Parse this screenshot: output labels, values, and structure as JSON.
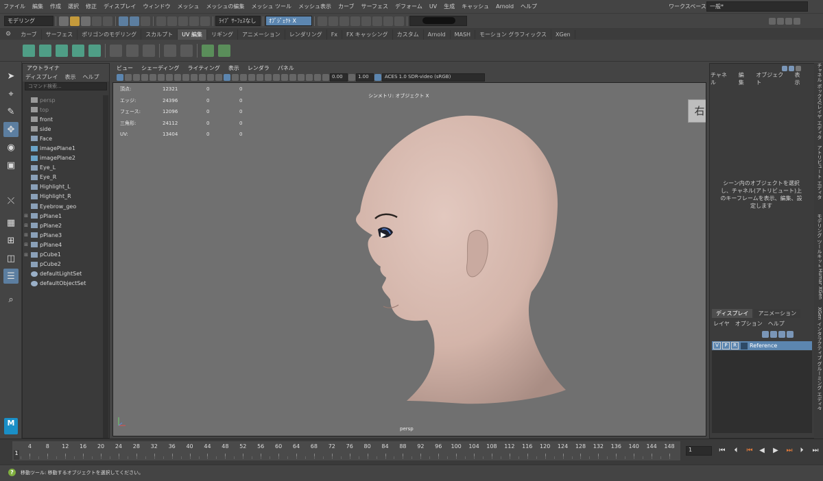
{
  "menubar": {
    "items": [
      "ファイル",
      "編集",
      "作成",
      "選択",
      "修正",
      "ディスプレイ",
      "ウィンドウ",
      "メッシュ",
      "メッシュの編集",
      "メッシュ ツール",
      "メッシュ表示",
      "カーブ",
      "サーフェス",
      "デフォーム",
      "UV",
      "生成",
      "キャッシュ",
      "Arnold",
      "ヘルプ"
    ],
    "workspace_label": "ワークスペース:",
    "workspace_value": "一般*"
  },
  "statusline": {
    "mode": "モデリング",
    "live_surface": "ﾗｲﾌﾞ ｻｰﾌｪｽなし",
    "symmetry": "ｵﾌﾞｼﾞｪｸﾄ X"
  },
  "shelf": {
    "tabs": [
      "カーブ",
      "サーフェス",
      "ポリゴンのモデリング",
      "スカルプト",
      "UV 編集",
      "リギング",
      "アニメーション",
      "レンダリング",
      "Fx",
      "FX キャッシング",
      "カスタム",
      "Arnold",
      "MASH",
      "モーション グラフィックス",
      "XGen"
    ],
    "active_tab": "UV 編集"
  },
  "outliner": {
    "title": "アウトライナ",
    "menu": [
      "ディスプレイ",
      "表示",
      "ヘルプ"
    ],
    "search_placeholder": "コマンド検索...",
    "items": [
      {
        "label": "persp",
        "icon": "camera-icon",
        "expand": "",
        "dim": true
      },
      {
        "label": "top",
        "icon": "camera-icon",
        "expand": "",
        "dim": true
      },
      {
        "label": "front",
        "icon": "camera-icon",
        "expand": "",
        "dim": false
      },
      {
        "label": "side",
        "icon": "camera-icon",
        "expand": "",
        "dim": false
      },
      {
        "label": "Face",
        "icon": "transform-icon",
        "expand": "",
        "dim": false
      },
      {
        "label": "imagePlane1",
        "icon": "image-plane-icon",
        "expand": "",
        "dim": false
      },
      {
        "label": "imagePlane2",
        "icon": "image-plane-icon",
        "expand": "",
        "dim": false
      },
      {
        "label": "Eye_L",
        "icon": "transform-icon",
        "expand": "",
        "dim": false
      },
      {
        "label": "Eye_R",
        "icon": "transform-icon",
        "expand": "",
        "dim": false
      },
      {
        "label": "Highlight_L",
        "icon": "transform-icon",
        "expand": "",
        "dim": false
      },
      {
        "label": "Highlight_R",
        "icon": "transform-icon",
        "expand": "",
        "dim": false
      },
      {
        "label": "Eyebrow_geo",
        "icon": "transform-icon",
        "expand": "",
        "dim": false
      },
      {
        "label": "pPlane1",
        "icon": "transform-icon",
        "expand": "⊞",
        "dim": false
      },
      {
        "label": "pPlane2",
        "icon": "transform-icon",
        "expand": "⊞",
        "dim": false
      },
      {
        "label": "pPlane3",
        "icon": "transform-icon",
        "expand": "⊞",
        "dim": false
      },
      {
        "label": "pPlane4",
        "icon": "transform-icon",
        "expand": "⊞",
        "dim": false
      },
      {
        "label": "pCube1",
        "icon": "transform-icon",
        "expand": "⊞",
        "dim": false
      },
      {
        "label": "pCube2",
        "icon": "transform-icon",
        "expand": "",
        "dim": false
      },
      {
        "label": "defaultLightSet",
        "icon": "set-icon",
        "expand": "",
        "dim": false
      },
      {
        "label": "defaultObjectSet",
        "icon": "set-icon",
        "expand": "",
        "dim": false
      }
    ]
  },
  "viewport": {
    "menu": [
      "ビュー",
      "シェーディング",
      "ライティング",
      "表示",
      "レンダラ",
      "パネル"
    ],
    "field_a": "0.00",
    "field_b": "1.00",
    "color_space": "ACES 1.0 SDR-video (sRGB)",
    "hud": [
      {
        "label": "頂点:",
        "v": "12321",
        "a": "0",
        "b": "0"
      },
      {
        "label": "エッジ:",
        "v": "24396",
        "a": "0",
        "b": "0"
      },
      {
        "label": "フェース:",
        "v": "12096",
        "a": "0",
        "b": "0"
      },
      {
        "label": "三角形:",
        "v": "24112",
        "a": "0",
        "b": "0"
      },
      {
        "label": "UV:",
        "v": "13404",
        "a": "0",
        "b": "0"
      }
    ],
    "symmetry_label": "シンメトリ: オブジェクト X",
    "view_cube": "右",
    "camera": "persp"
  },
  "channel_box": {
    "menu": [
      "チャネル",
      "編集",
      "オブジェクト",
      "表示"
    ],
    "message": "シーン内のオブジェクトを選択し、チャネル(アトリビュート)上のキーフレームを表示、編集、設定します",
    "side_tabs": [
      "チャネル ボックス/レイヤ エディタ",
      "アトリビュート エディタ",
      "モデリング ツールキット",
      "Human IK",
      "XGen",
      "XGen インタラクティブ グルーミング エディタ"
    ]
  },
  "layer_editor": {
    "tabs": [
      "ディスプレイ",
      "アニメーション"
    ],
    "menu": [
      "レイヤ",
      "オプション",
      "ヘルプ"
    ],
    "layer": {
      "v": "V",
      "p": "P",
      "r": "R",
      "name": "Reference"
    }
  },
  "timeline": {
    "ticks": [
      "1",
      "4",
      "8",
      "12",
      "16",
      "20",
      "24",
      "28",
      "32",
      "36",
      "40",
      "44",
      "48",
      "52",
      "56",
      "60",
      "64",
      "68",
      "72",
      "76",
      "80",
      "84",
      "88",
      "92",
      "96",
      "100",
      "104",
      "108",
      "112",
      "116",
      "120",
      "124",
      "128",
      "132",
      "136",
      "140",
      "144",
      "148"
    ],
    "current_frame": "1",
    "current_label": "1"
  },
  "helpline": {
    "text": "移動ツール: 移動するオブジェクトを選択してください。"
  },
  "colors": {
    "accent": "#5c86b0",
    "viewport_bg": "#707070",
    "skin": "#d9bcb2"
  }
}
